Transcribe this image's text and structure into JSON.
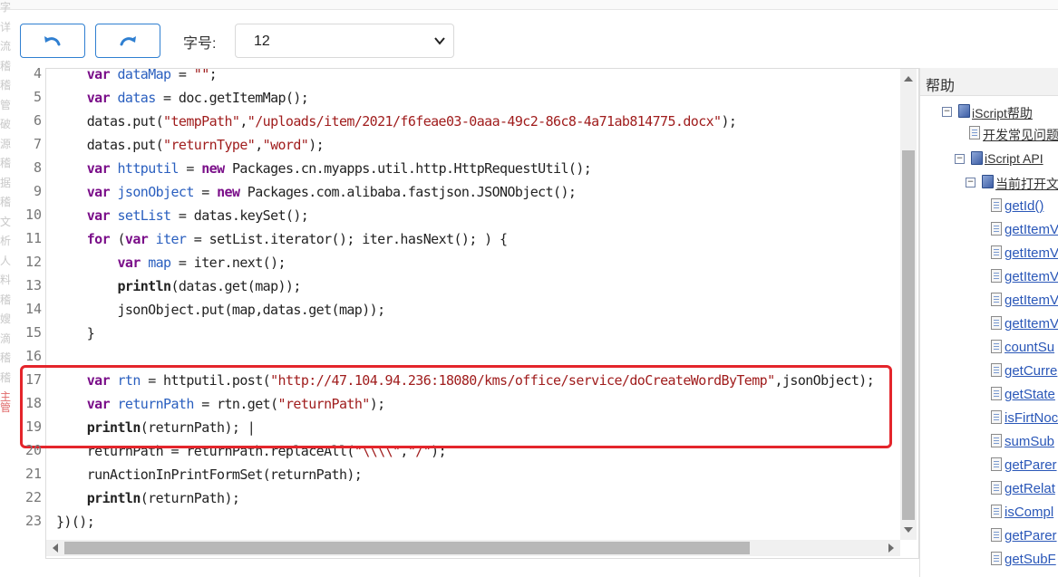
{
  "toolbar": {
    "undo_icon": "undo-icon",
    "redo_icon": "redo-icon",
    "font_size_label": "字号:",
    "font_size_value": "12",
    "accent_color": "#2f7fd1"
  },
  "left_gutter_chars": [
    "字",
    "详",
    "流",
    "稽",
    "稽",
    "管",
    "破",
    "源",
    "稽",
    "据",
    "稽",
    "文",
    "析",
    "人",
    "料",
    "稽",
    "嫂",
    "滴",
    "稽",
    "稽",
    "主管"
  ],
  "editor": {
    "lines": [
      {
        "num": "4",
        "html": "    <span class='kw'>var</span> <span class='var'>dataMap</span> = <span class='str'>\"\"</span>;"
      },
      {
        "num": "5",
        "html": "    <span class='kw'>var</span> <span class='var'>datas</span> = doc.getItemMap();"
      },
      {
        "num": "6",
        "html": "    datas.put(<span class='str'>\"tempPath\"</span>,<span class='str'>\"/uploads/item/2021/f6feae03-0aaa-49c2-86c8-4a71ab814775.docx\"</span>);"
      },
      {
        "num": "7",
        "html": "    datas.put(<span class='str'>\"returnType\"</span>,<span class='str'>\"word\"</span>);"
      },
      {
        "num": "8",
        "html": "    <span class='kw'>var</span> <span class='var'>httputil</span> = <span class='kw'>new</span> Packages.cn.myapps.util.http.HttpRequestUtil();"
      },
      {
        "num": "9",
        "html": "    <span class='kw'>var</span> <span class='var'>jsonObject</span> = <span class='kw'>new</span> Packages.com.alibaba.fastjson.JSONObject();"
      },
      {
        "num": "10",
        "html": "    <span class='kw'>var</span> <span class='var'>setList</span> = datas.keySet();"
      },
      {
        "num": "11",
        "html": "    <span class='kw'>for</span> (<span class='kw'>var</span> <span class='var'>iter</span> = setList.iterator(); iter.hasNext(); ) {"
      },
      {
        "num": "12",
        "html": "        <span class='kw'>var</span> <span class='var'>map</span> = iter.next();"
      },
      {
        "num": "13",
        "html": "        <span class='fn'>println</span>(datas.get(map));"
      },
      {
        "num": "14",
        "html": "        jsonObject.put(map,datas.get(map));"
      },
      {
        "num": "15",
        "html": "    }"
      },
      {
        "num": "16",
        "html": ""
      },
      {
        "num": "17",
        "html": "    <span class='kw'>var</span> <span class='var'>rtn</span> = httputil.post(<span class='str'>\"http://47.104.94.236:18080/kms/office/service/doCreateWordByTemp\"</span>,jsonObject);"
      },
      {
        "num": "18",
        "html": "    <span class='kw'>var</span> <span class='var'>returnPath</span> = rtn.get(<span class='str'>\"returnPath\"</span>);"
      },
      {
        "num": "19",
        "html": "    <span class='fn'>println</span>(returnPath); |"
      },
      {
        "num": "20",
        "html": "    returnPath = returnPath.replaceAll(<span class='str'>\"\\\\\\\\\"</span>,<span class='str'>\"/\"</span>);"
      },
      {
        "num": "21",
        "html": "    runActionInPrintFormSet(returnPath);"
      },
      {
        "num": "22",
        "html": "    <span class='fn'>println</span>(returnPath);"
      },
      {
        "num": "23",
        "html": "})();"
      }
    ],
    "highlight_color": "#e4252b"
  },
  "help": {
    "title": "帮助",
    "tree": [
      {
        "level": 0,
        "toggle": "⊟",
        "icon": "book",
        "label": "iScript帮助",
        "style": "node"
      },
      {
        "level": 1,
        "toggle": "",
        "icon": "page",
        "label": "开发常见问题",
        "style": "node"
      },
      {
        "level": 1,
        "toggle": "⊟",
        "icon": "book",
        "label": "iScript API",
        "style": "node"
      },
      {
        "level": 2,
        "toggle": "⊟",
        "icon": "book",
        "label": "当前打开文档",
        "style": "node"
      },
      {
        "level": 3,
        "toggle": "",
        "icon": "page",
        "label": "getId()",
        "style": "link"
      },
      {
        "level": 3,
        "toggle": "",
        "icon": "page",
        "label": "getItemV",
        "style": "link"
      },
      {
        "level": 3,
        "toggle": "",
        "icon": "page",
        "label": "getItemV",
        "style": "link"
      },
      {
        "level": 3,
        "toggle": "",
        "icon": "page",
        "label": "getItemV",
        "style": "link"
      },
      {
        "level": 3,
        "toggle": "",
        "icon": "page",
        "label": "getItemV",
        "style": "link"
      },
      {
        "level": 3,
        "toggle": "",
        "icon": "page",
        "label": "getItemV",
        "style": "link"
      },
      {
        "level": 3,
        "toggle": "",
        "icon": "page",
        "label": "countSu",
        "style": "link"
      },
      {
        "level": 3,
        "toggle": "",
        "icon": "page",
        "label": "getCurre",
        "style": "link"
      },
      {
        "level": 3,
        "toggle": "",
        "icon": "page",
        "label": "getState",
        "style": "link"
      },
      {
        "level": 3,
        "toggle": "",
        "icon": "page",
        "label": "isFirtNoc",
        "style": "link"
      },
      {
        "level": 3,
        "toggle": "",
        "icon": "page",
        "label": "sumSub",
        "style": "link"
      },
      {
        "level": 3,
        "toggle": "",
        "icon": "page",
        "label": "getParer",
        "style": "link"
      },
      {
        "level": 3,
        "toggle": "",
        "icon": "page",
        "label": "getRelat",
        "style": "link"
      },
      {
        "level": 3,
        "toggle": "",
        "icon": "page",
        "label": "isCompl",
        "style": "link"
      },
      {
        "level": 3,
        "toggle": "",
        "icon": "page",
        "label": "getParer",
        "style": "link"
      },
      {
        "level": 3,
        "toggle": "",
        "icon": "page",
        "label": "getSubF",
        "style": "link"
      }
    ]
  }
}
